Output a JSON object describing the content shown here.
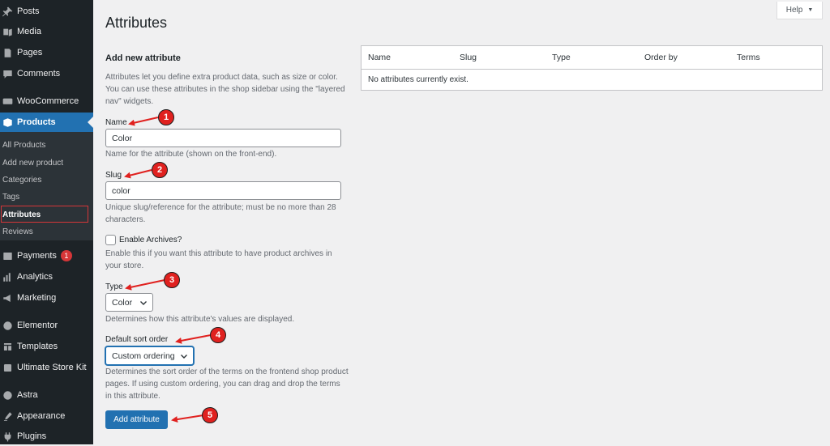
{
  "sidebar": {
    "items": [
      {
        "label": "Posts",
        "icon": "pin-icon"
      },
      {
        "label": "Media",
        "icon": "media-icon"
      },
      {
        "label": "Pages",
        "icon": "pages-icon"
      },
      {
        "label": "Comments",
        "icon": "comments-icon"
      },
      {
        "label": "WooCommerce",
        "icon": "woocommerce-icon"
      },
      {
        "label": "Products",
        "icon": "products-icon"
      },
      {
        "label": "Payments",
        "icon": "payments-icon",
        "badge": "1"
      },
      {
        "label": "Analytics",
        "icon": "analytics-icon"
      },
      {
        "label": "Marketing",
        "icon": "marketing-icon"
      },
      {
        "label": "Elementor",
        "icon": "elementor-icon"
      },
      {
        "label": "Templates",
        "icon": "templates-icon"
      },
      {
        "label": "Ultimate Store Kit",
        "icon": "store-kit-icon"
      },
      {
        "label": "Astra",
        "icon": "astra-icon"
      },
      {
        "label": "Appearance",
        "icon": "appearance-icon"
      },
      {
        "label": "Plugins",
        "icon": "plugins-icon"
      }
    ],
    "submenu": [
      "All Products",
      "Add new product",
      "Categories",
      "Tags",
      "Attributes",
      "Reviews"
    ],
    "active_item": "Products",
    "current_sub": "Attributes"
  },
  "header": {
    "help_label": "Help",
    "page_title": "Attributes"
  },
  "form": {
    "heading": "Add new attribute",
    "intro": "Attributes let you define extra product data, such as size or color. You can use these attributes in the shop sidebar using the \"layered nav\" widgets.",
    "name_label": "Name",
    "name_value": "Color",
    "name_desc": "Name for the attribute (shown on the front-end).",
    "slug_label": "Slug",
    "slug_value": "color",
    "slug_desc": "Unique slug/reference for the attribute; must be no more than 28 characters.",
    "archives_label": "Enable Archives?",
    "archives_desc": "Enable this if you want this attribute to have product archives in your store.",
    "type_label": "Type",
    "type_value": "Color",
    "type_desc": "Determines how this attribute's values are displayed.",
    "sort_label": "Default sort order",
    "sort_value": "Custom ordering",
    "sort_desc": "Determines the sort order of the terms on the frontend shop product pages. If using custom ordering, you can drag and drop the terms in this attribute.",
    "submit_label": "Add attribute"
  },
  "table": {
    "columns": [
      "Name",
      "Slug",
      "Type",
      "Order by",
      "Terms"
    ],
    "empty_message": "No attributes currently exist."
  },
  "callouts": [
    "1",
    "2",
    "3",
    "4",
    "5"
  ],
  "colors": {
    "sidebar_bg": "#1d2327",
    "accent": "#2271b1",
    "callout_red": "#e0211f"
  }
}
